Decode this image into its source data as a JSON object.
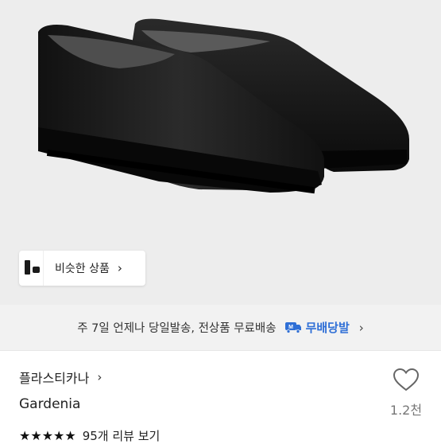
{
  "similar_products": {
    "label": "비슷한 상품",
    "chevron": "›"
  },
  "shipping": {
    "text": "주 7일 언제나 당일발송, 전상품 무료배송",
    "badge_icon": "m-delivery-truck-icon",
    "badge_label": "무배당발",
    "chevron": "›"
  },
  "store": {
    "name": "플라스티카나",
    "chevron": "›"
  },
  "product": {
    "brand": "Gardenia"
  },
  "rating": {
    "stars": "★★★★★",
    "value": 4.5,
    "review_text": "95개 리뷰 보기"
  },
  "like": {
    "icon": "heart-outline-icon",
    "count": "1.2천"
  },
  "colors": {
    "accent": "#2f6fd6",
    "hero_bg": "#ededed",
    "banner_bg": "#f2f2f2"
  }
}
